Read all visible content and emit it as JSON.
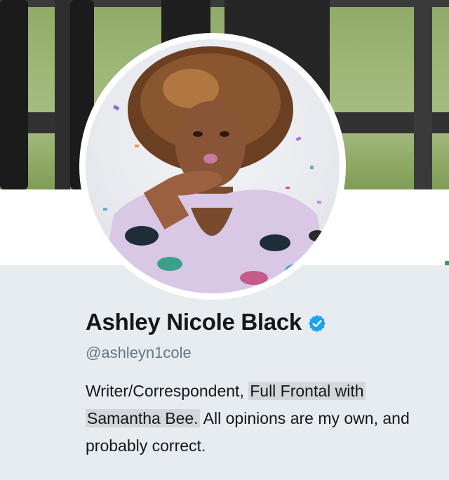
{
  "profile": {
    "name": "Ashley Nicole Black",
    "handle": "@ashleyn1cole",
    "verified_icon": "verified-badge-icon",
    "bio": {
      "prefix": "Writer/Correspondent, ",
      "link_part1": "Full Frontal with",
      "link_part2": "Samantha Bee.",
      "suffix": " All opinions are my own, and probably correct."
    }
  },
  "colors": {
    "page_background": "#e6ecf0",
    "name": "#14171a",
    "handle": "#657786",
    "verified": "#1da1f2",
    "link_highlight": "#d3d6da"
  }
}
